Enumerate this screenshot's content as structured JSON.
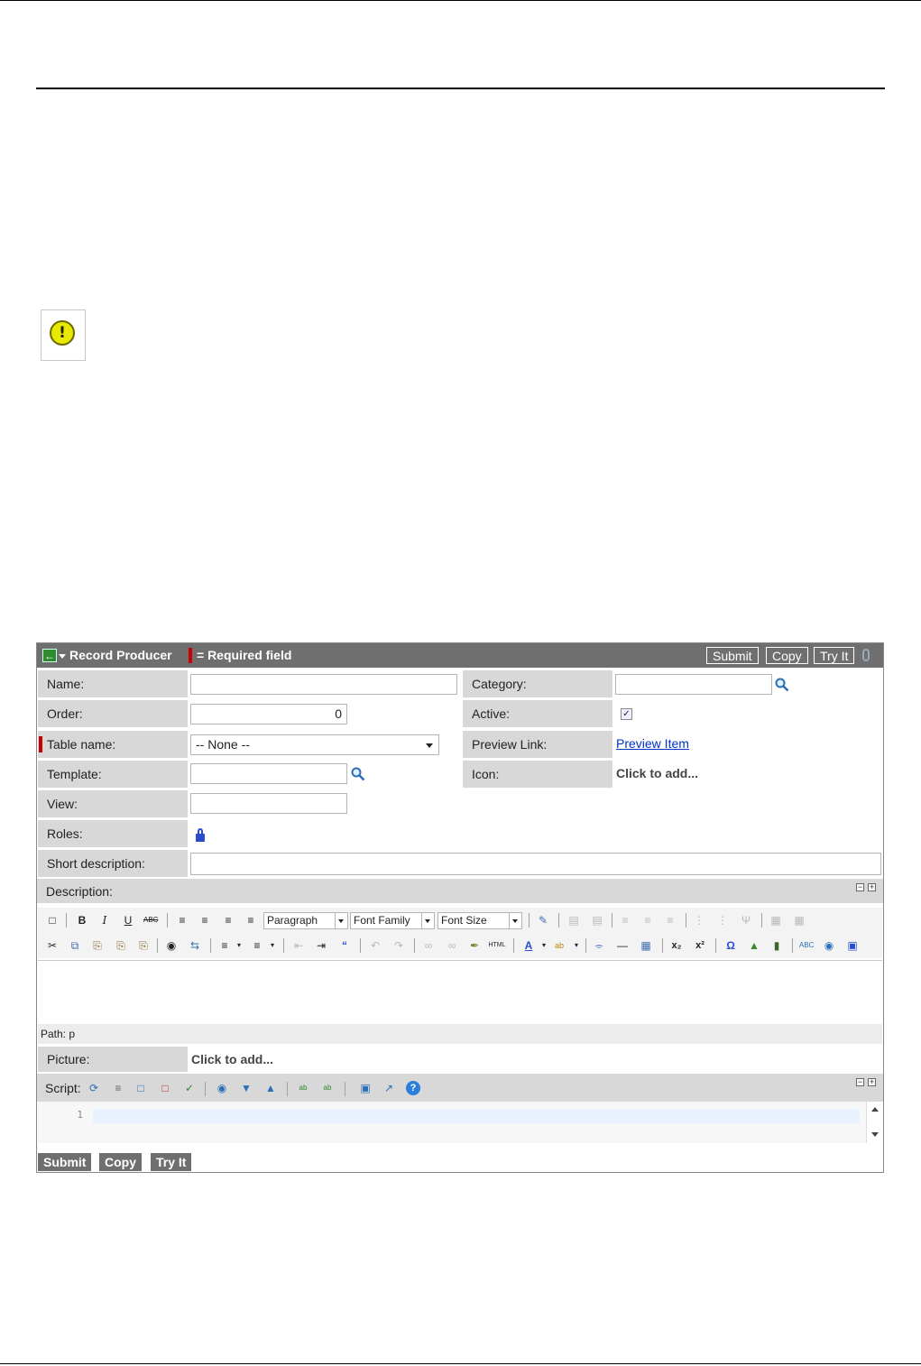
{
  "header": {
    "title": "Record Producer",
    "required_legend": "= Required field",
    "buttons": {
      "submit": "Submit",
      "copy": "Copy",
      "try_it": "Try It"
    }
  },
  "fields": {
    "name": {
      "label": "Name:",
      "value": ""
    },
    "order": {
      "label": "Order:",
      "value": "0"
    },
    "table_name": {
      "label": "Table name:",
      "value": "-- None --"
    },
    "template": {
      "label": "Template:",
      "value": ""
    },
    "view": {
      "label": "View:",
      "value": ""
    },
    "roles": {
      "label": "Roles:"
    },
    "short_description": {
      "label": "Short description:",
      "value": ""
    },
    "category": {
      "label": "Category:",
      "value": ""
    },
    "active": {
      "label": "Active:",
      "checked": true
    },
    "preview_link": {
      "label": "Preview Link:",
      "link_text": "Preview Item"
    },
    "icon": {
      "label": "Icon:",
      "value": "Click to add..."
    },
    "description": {
      "label": "Description:"
    },
    "picture": {
      "label": "Picture:",
      "value": "Click to add..."
    },
    "script": {
      "label": "Script:"
    }
  },
  "editor": {
    "format_select": "Paragraph",
    "font_family_select": "Font Family",
    "font_size_select": "Font Size",
    "path": "Path: p"
  },
  "script_editor": {
    "line_number": "1"
  },
  "footer": {
    "submit": "Submit",
    "copy": "Copy",
    "try_it": "Try It"
  }
}
